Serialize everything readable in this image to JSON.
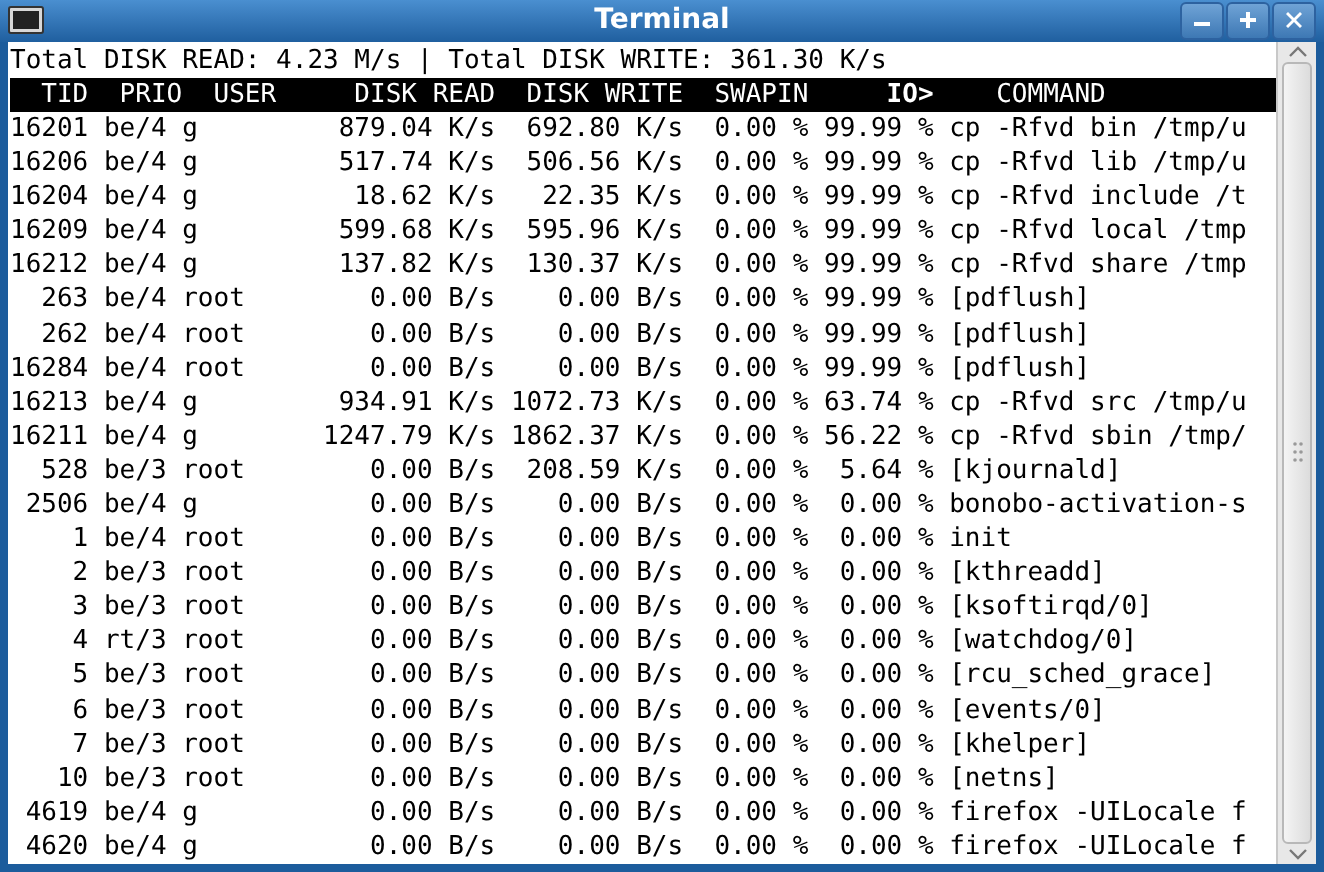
{
  "window": {
    "title": "Terminal"
  },
  "summary": "Total DISK READ: 4.23 M/s | Total DISK WRITE: 361.30 K/s",
  "header": "  TID  PRIO  USER     DISK READ  DISK WRITE  SWAPIN     **IO>**    COMMAND",
  "rows": [
    "16201 be/4 g         879.04 K/s  692.80 K/s  0.00 % 99.99 % cp -Rfvd bin /tmp/u",
    "16206 be/4 g         517.74 K/s  506.56 K/s  0.00 % 99.99 % cp -Rfvd lib /tmp/u",
    "16204 be/4 g          18.62 K/s   22.35 K/s  0.00 % 99.99 % cp -Rfvd include /t",
    "16209 be/4 g         599.68 K/s  595.96 K/s  0.00 % 99.99 % cp -Rfvd local /tmp",
    "16212 be/4 g         137.82 K/s  130.37 K/s  0.00 % 99.99 % cp -Rfvd share /tmp",
    "  263 be/4 root        0.00 B/s    0.00 B/s  0.00 % 99.99 % [pdflush]",
    "  262 be/4 root        0.00 B/s    0.00 B/s  0.00 % 99.99 % [pdflush]",
    "16284 be/4 root        0.00 B/s    0.00 B/s  0.00 % 99.99 % [pdflush]",
    "16213 be/4 g         934.91 K/s 1072.73 K/s  0.00 % 63.74 % cp -Rfvd src /tmp/u",
    "16211 be/4 g        1247.79 K/s 1862.37 K/s  0.00 % 56.22 % cp -Rfvd sbin /tmp/",
    "  528 be/3 root        0.00 B/s  208.59 K/s  0.00 %  5.64 % [kjournald]",
    " 2506 be/4 g           0.00 B/s    0.00 B/s  0.00 %  0.00 % bonobo-activation-s",
    "    1 be/4 root        0.00 B/s    0.00 B/s  0.00 %  0.00 % init",
    "    2 be/3 root        0.00 B/s    0.00 B/s  0.00 %  0.00 % [kthreadd]",
    "    3 be/3 root        0.00 B/s    0.00 B/s  0.00 %  0.00 % [ksoftirqd/0]",
    "    4 rt/3 root        0.00 B/s    0.00 B/s  0.00 %  0.00 % [watchdog/0]",
    "    5 be/3 root        0.00 B/s    0.00 B/s  0.00 %  0.00 % [rcu_sched_grace]",
    "    6 be/3 root        0.00 B/s    0.00 B/s  0.00 %  0.00 % [events/0]",
    "    7 be/3 root        0.00 B/s    0.00 B/s  0.00 %  0.00 % [khelper]",
    "   10 be/3 root        0.00 B/s    0.00 B/s  0.00 %  0.00 % [netns]",
    " 4619 be/4 g           0.00 B/s    0.00 B/s  0.00 %  0.00 % firefox -UILocale f",
    " 4620 be/4 g           0.00 B/s    0.00 B/s  0.00 %  0.00 % firefox -UILocale f"
  ]
}
